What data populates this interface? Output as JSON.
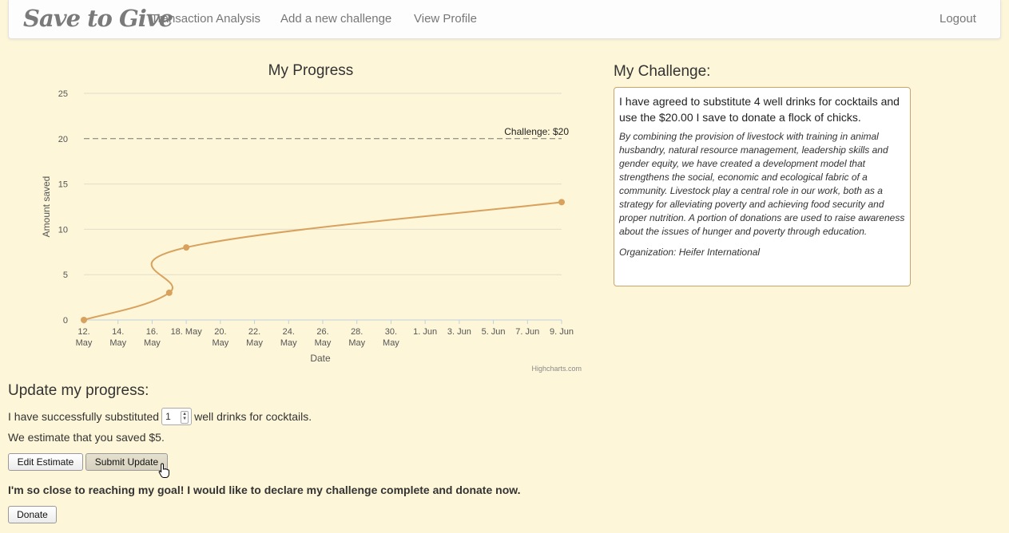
{
  "nav": {
    "brand": "Save to Give",
    "links": [
      "Transaction Analysis",
      "Add a new challenge",
      "View Profile"
    ],
    "logout": "Logout"
  },
  "chart_data": {
    "type": "line",
    "title": "My Progress",
    "xlabel": "Date",
    "ylabel": "Amount saved",
    "x": [
      "2014-05-12",
      "2014-05-17",
      "2014-05-18",
      "2014-06-09"
    ],
    "series": [
      {
        "values": [
          0,
          3,
          8,
          13
        ],
        "color": "#d8a25e"
      }
    ],
    "ylim": [
      0,
      25
    ],
    "yticks": [
      0,
      5,
      10,
      15,
      20,
      25
    ],
    "xticks": [
      {
        "line1": "12.",
        "line2": "May"
      },
      {
        "line1": "14.",
        "line2": "May"
      },
      {
        "line1": "16.",
        "line2": "May"
      },
      {
        "line1": "18. May",
        "line2": ""
      },
      {
        "line1": "20.",
        "line2": "May"
      },
      {
        "line1": "22.",
        "line2": "May"
      },
      {
        "line1": "24.",
        "line2": "May"
      },
      {
        "line1": "26.",
        "line2": "May"
      },
      {
        "line1": "28.",
        "line2": "May"
      },
      {
        "line1": "30.",
        "line2": "May"
      },
      {
        "line1": "1. Jun",
        "line2": ""
      },
      {
        "line1": "3. Jun",
        "line2": ""
      },
      {
        "line1": "5. Jun",
        "line2": ""
      },
      {
        "line1": "7. Jun",
        "line2": ""
      },
      {
        "line1": "9. Jun",
        "line2": ""
      }
    ],
    "plotline": {
      "value": 20,
      "label": "Challenge: $20"
    },
    "credit": "Highcharts.com",
    "grid": true,
    "legend": "none"
  },
  "challenge": {
    "heading": "My Challenge:",
    "statement": "I have agreed to substitute 4 well drinks for cocktails and use the $20.00 I save to donate a flock of chicks.",
    "description": "By combining the provision of livestock with training in animal husbandry, natural resource management, leadership skills and gender equity, we have created a development model that strengthens the social, economic and ecological fabric of a community. Livestock play a central role in our work, both as a strategy for alleviating poverty and achieving food security and proper nutrition. A portion of donations are used to raise awareness about the issues of hunger and poverty through education.",
    "organization": "Organization: Heifer International"
  },
  "update": {
    "heading": "Update my progress:",
    "prefix": "I have successfully substituted",
    "quantity": "1",
    "suffix": "well drinks for cocktails.",
    "estimate": "We estimate that you saved $5.",
    "edit_label": "Edit Estimate",
    "submit_label": "Submit Update",
    "goal_text": "I'm so close to reaching my goal! I would like to declare my challenge complete and donate now.",
    "donate_label": "Donate"
  }
}
